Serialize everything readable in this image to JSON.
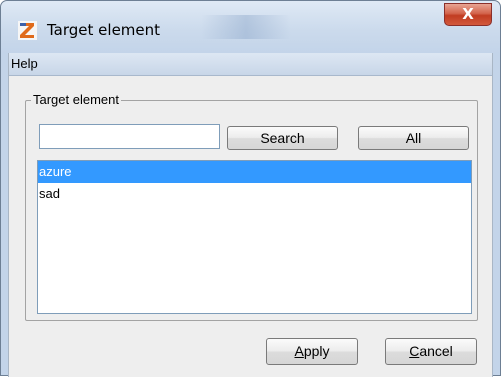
{
  "window": {
    "title": "Target element",
    "close_glyph": "X",
    "icon": "app-logo-icon"
  },
  "menu": {
    "help": "Help"
  },
  "group": {
    "legend": "Target element"
  },
  "search": {
    "value": "",
    "search_label": "Search",
    "all_label": "All"
  },
  "list": {
    "items": [
      "azure",
      "sad"
    ],
    "selected": "azure"
  },
  "buttons": {
    "apply_mnemonic": "A",
    "apply_rest": "pply",
    "cancel_mnemonic": "C",
    "cancel_rest": "ancel"
  },
  "colors": {
    "selection": "#3399ff",
    "close_button": "#c9452a",
    "client_bg": "#eeeeee"
  }
}
